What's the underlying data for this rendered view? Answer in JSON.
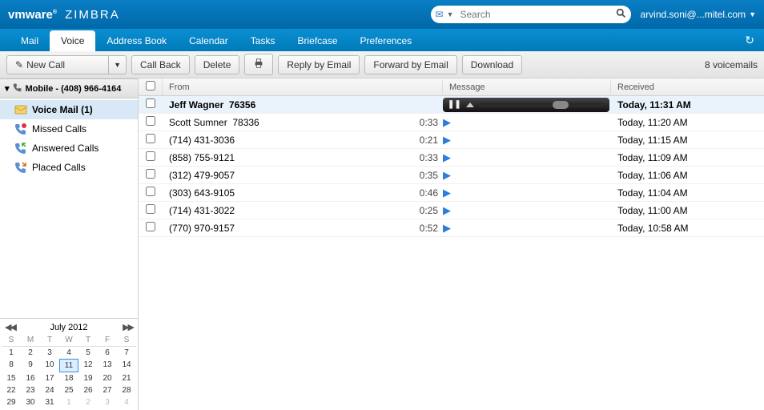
{
  "header": {
    "logo_brand": "vmware",
    "logo_product": "ZIMBRA",
    "search_placeholder": "Search",
    "user": "arvind.soni@...mitel.com"
  },
  "nav": {
    "items": [
      "Mail",
      "Voice",
      "Address Book",
      "Calendar",
      "Tasks",
      "Briefcase",
      "Preferences"
    ],
    "active": 1
  },
  "toolbar": {
    "new_call": "New Call",
    "call_back": "Call Back",
    "delete": "Delete",
    "reply_email": "Reply by Email",
    "forward_email": "Forward by Email",
    "download": "Download",
    "count_text": "8 voicemails"
  },
  "sidebar": {
    "header": "Mobile - (408) 966-4164",
    "items": [
      {
        "label": "Voice Mail (1)"
      },
      {
        "label": "Missed Calls"
      },
      {
        "label": "Answered Calls"
      },
      {
        "label": "Placed Calls"
      }
    ]
  },
  "columns": {
    "from": "From",
    "message": "Message",
    "received": "Received"
  },
  "calendar": {
    "title": "July 2012",
    "dow": [
      "S",
      "M",
      "T",
      "W",
      "T",
      "F",
      "S"
    ],
    "weeks": [
      [
        {
          "d": 1
        },
        {
          "d": 2
        },
        {
          "d": 3
        },
        {
          "d": 4
        },
        {
          "d": 5
        },
        {
          "d": 6
        },
        {
          "d": 7
        }
      ],
      [
        {
          "d": 8
        },
        {
          "d": 9
        },
        {
          "d": 10
        },
        {
          "d": 11,
          "today": true
        },
        {
          "d": 12
        },
        {
          "d": 13
        },
        {
          "d": 14
        }
      ],
      [
        {
          "d": 15
        },
        {
          "d": 16
        },
        {
          "d": 17
        },
        {
          "d": 18
        },
        {
          "d": 19
        },
        {
          "d": 20
        },
        {
          "d": 21
        }
      ],
      [
        {
          "d": 22
        },
        {
          "d": 23
        },
        {
          "d": 24
        },
        {
          "d": 25
        },
        {
          "d": 26
        },
        {
          "d": 27
        },
        {
          "d": 28
        }
      ],
      [
        {
          "d": 29
        },
        {
          "d": 30
        },
        {
          "d": 31
        },
        {
          "d": 1,
          "muted": true
        },
        {
          "d": 2,
          "muted": true
        },
        {
          "d": 3,
          "muted": true
        },
        {
          "d": 4,
          "muted": true
        }
      ]
    ]
  },
  "voicemails": [
    {
      "from_name": "Jeff Wagner",
      "from_num": "76356",
      "duration": "",
      "received": "Today, 11:31 AM",
      "selected": true
    },
    {
      "from_name": "Scott Sumner",
      "from_num": "78336",
      "duration": "0:33",
      "received": "Today, 11:20 AM"
    },
    {
      "from_name": "",
      "from_num": "(714) 431-3036",
      "duration": "0:21",
      "received": "Today, 11:15 AM"
    },
    {
      "from_name": "",
      "from_num": "(858) 755-9121",
      "duration": "0:33",
      "received": "Today, 11:09 AM"
    },
    {
      "from_name": "",
      "from_num": "(312) 479-9057",
      "duration": "0:35",
      "received": "Today, 11:06 AM"
    },
    {
      "from_name": "",
      "from_num": "(303) 643-9105",
      "duration": "0:46",
      "received": "Today, 11:04 AM"
    },
    {
      "from_name": "",
      "from_num": "(714) 431-3022",
      "duration": "0:25",
      "received": "Today, 11:00 AM"
    },
    {
      "from_name": "",
      "from_num": "(770) 970-9157",
      "duration": "0:52",
      "received": "Today, 10:58 AM"
    }
  ]
}
